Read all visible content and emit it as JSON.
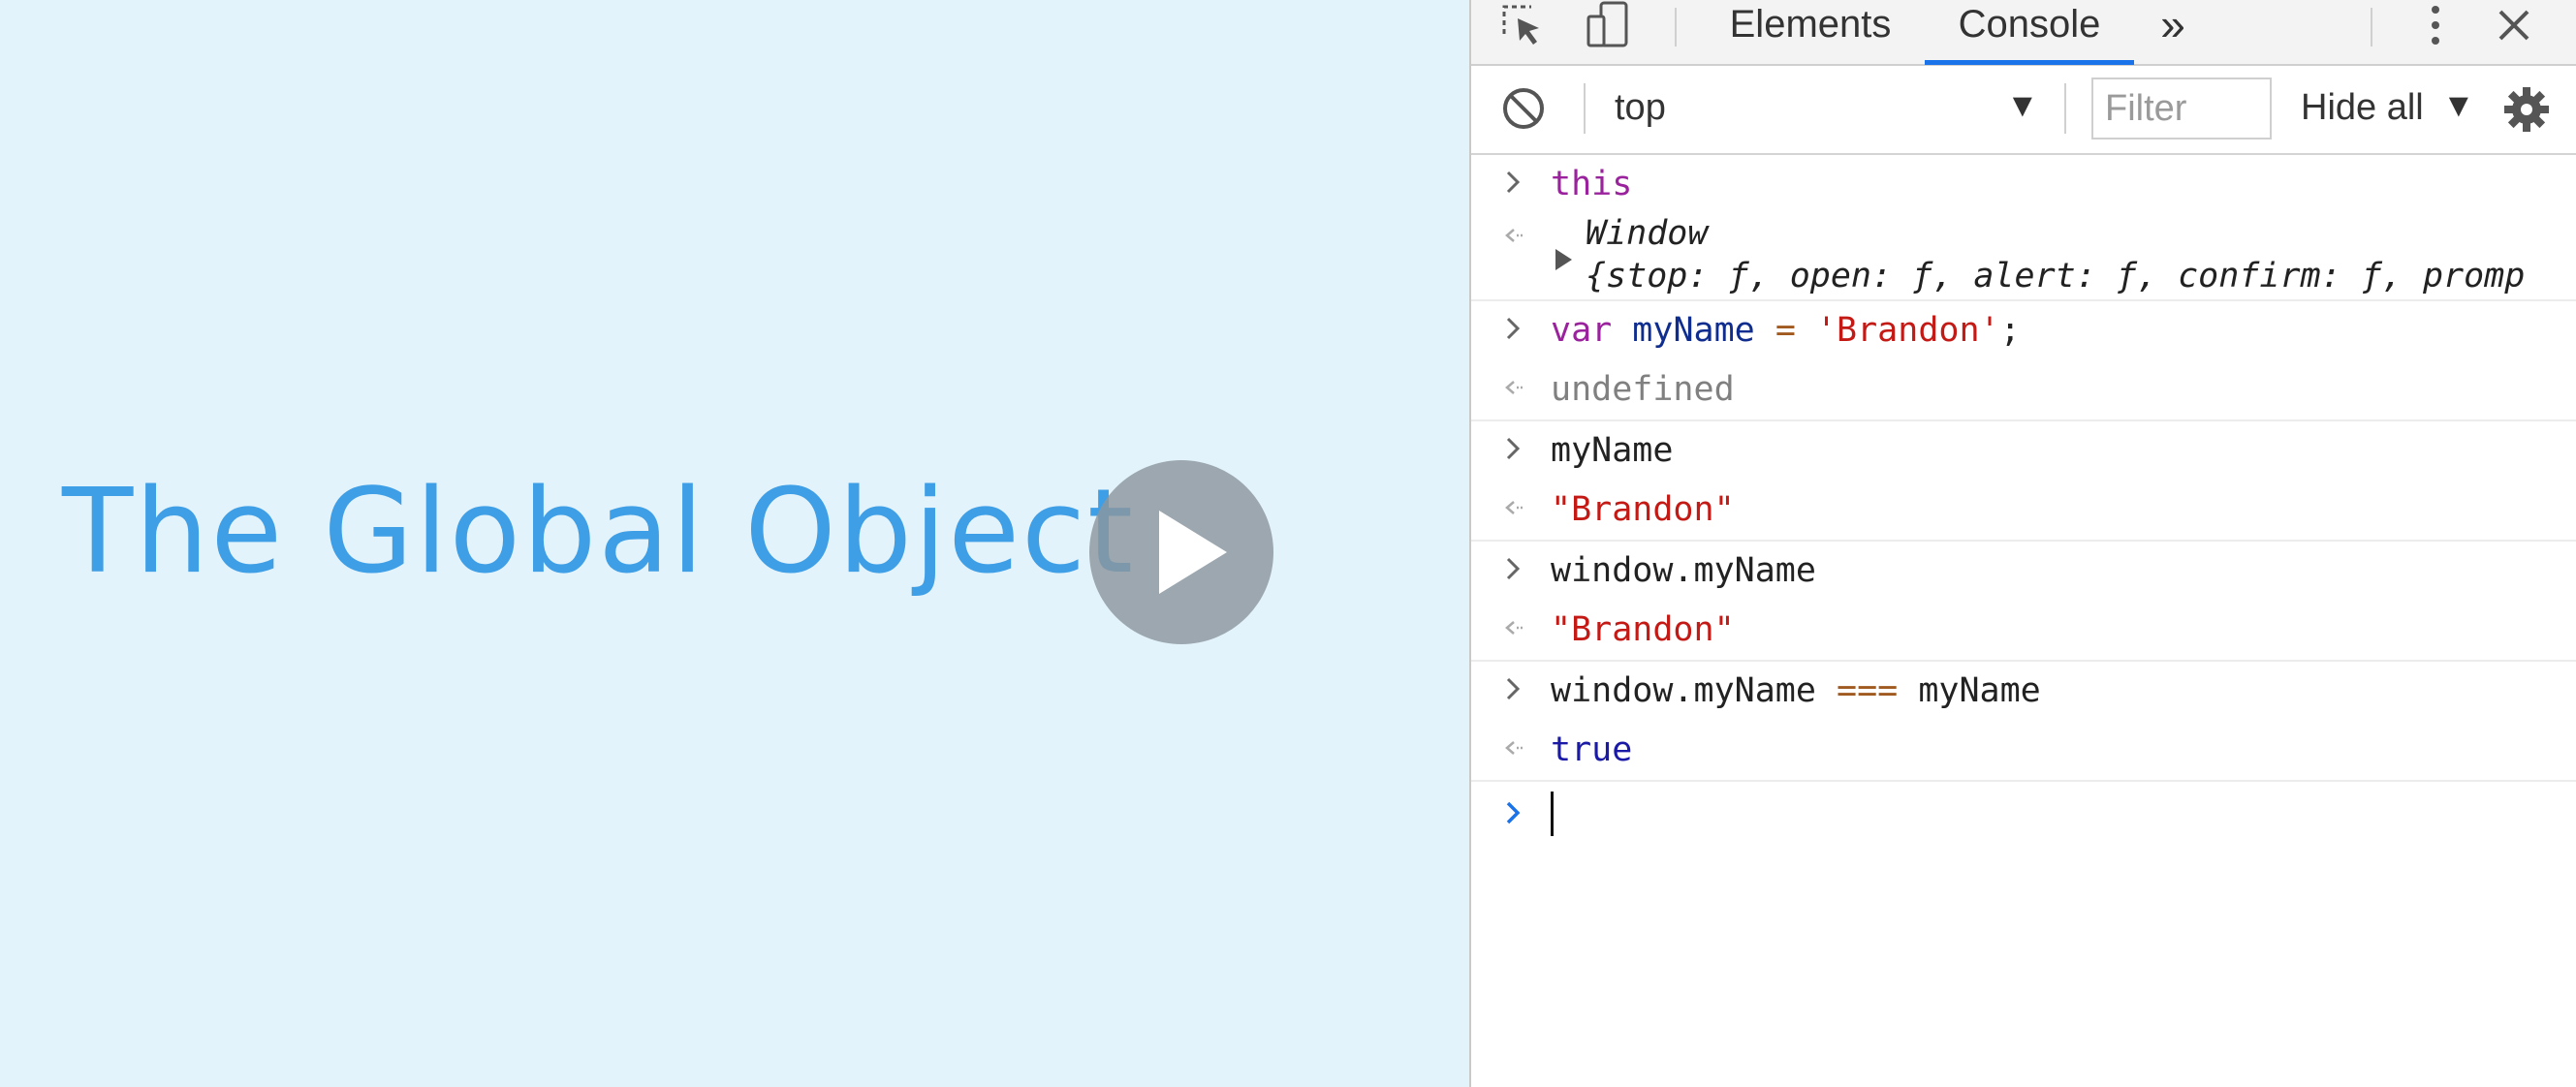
{
  "slide": {
    "title": "The Global Object"
  },
  "devtools": {
    "tabs": {
      "elements": "Elements",
      "console": "Console",
      "more": "»"
    },
    "toolbar": {
      "context": "top",
      "filter_placeholder": "Filter",
      "levels": "Hide all"
    },
    "messages": [
      {
        "type": "input",
        "parts": [
          "this"
        ]
      },
      {
        "type": "output",
        "line1": "Window",
        "line2": "{stop: ƒ, open: ƒ, alert: ƒ, confirm: ƒ, promp"
      },
      {
        "type": "input",
        "parts": [
          "var",
          "myName",
          "=",
          "'Brandon'",
          ";"
        ]
      },
      {
        "type": "output",
        "text": "undefined"
      },
      {
        "type": "input",
        "text": "myName"
      },
      {
        "type": "output",
        "text": "\"Brandon\""
      },
      {
        "type": "input",
        "text": "window.myName"
      },
      {
        "type": "output",
        "text": "\"Brandon\""
      },
      {
        "type": "input",
        "parts": [
          "window.myName",
          "===",
          "myName"
        ]
      },
      {
        "type": "output",
        "text": "true"
      }
    ]
  },
  "colors": {
    "slide_background": "#e3f3fb",
    "title_blue": "#3e9ee6",
    "tab_underline": "#1a73e8",
    "string_red": "#c41a16",
    "keyword_purple": "#9b229d"
  },
  "icons": [
    "inspect-element-icon",
    "device-toolbar-icon",
    "more-tabs-icon",
    "kebab-menu-icon",
    "close-icon",
    "clear-console-icon",
    "dropdown-arrow-icon",
    "settings-gear-icon",
    "play-icon",
    "input-chevron-icon",
    "output-arrow-icon",
    "expand-triangle-icon"
  ]
}
